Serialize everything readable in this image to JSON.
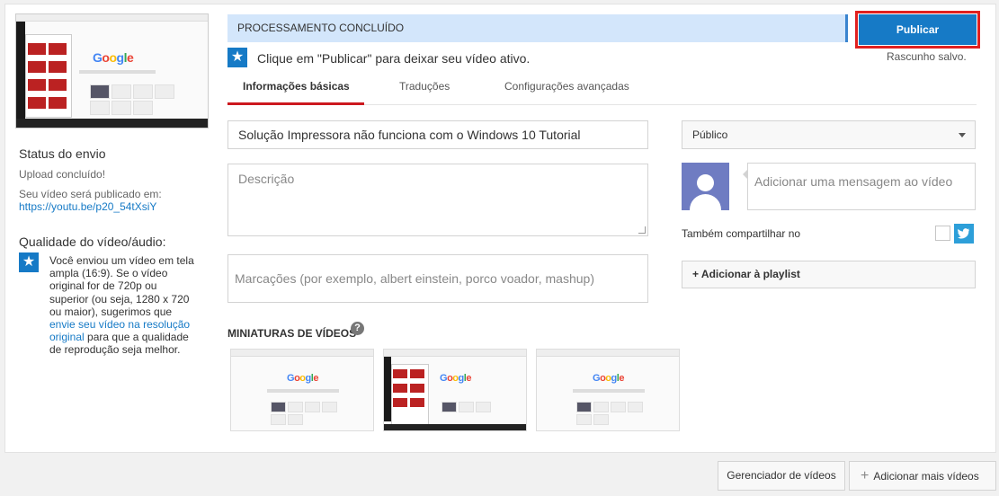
{
  "preview": {
    "google_text": [
      "G",
      "o",
      "o",
      "g",
      "l",
      "e"
    ]
  },
  "sidebar": {
    "status_title": "Status do envio",
    "upload_done": "Upload concluído!",
    "publish_note": "Seu vídeo será publicado em:",
    "video_url": "https://youtu.be/p20_54tXsiY",
    "quality_title": "Qualidade do vídeo/áudio:",
    "quality_pre": "Você enviou um vídeo em tela ampla (16:9). Se o vídeo original for de 720p ou superior (ou seja, 1280 x 720 ou maior), sugerimos que ",
    "quality_link": "envie seu vídeo na resolução original",
    "quality_post": " para que a qualidade de reprodução seja melhor."
  },
  "status": {
    "processing_label": "PROCESSAMENTO CONCLUÍDO",
    "publish_label": "Publicar",
    "draft_label": "Rascunho salvo.",
    "hint": "Clique em \"Publicar\" para deixar seu vídeo ativo."
  },
  "tabs": [
    {
      "label": "Informações básicas",
      "active": true
    },
    {
      "label": "Traduções",
      "active": false
    },
    {
      "label": "Configurações avançadas",
      "active": false
    }
  ],
  "form": {
    "title_value": "Solução Impressora não funciona com o Windows 10   Tutorial",
    "description_placeholder": "Descrição",
    "tags_placeholder": "Marcações (por exemplo, albert einstein, porco voador, mashup)",
    "privacy_value": "Público",
    "message_placeholder": "Adicionar uma mensagem ao vídeo",
    "share_label": "Também compartilhar no",
    "playlist_label": "+ Adicionar à playlist"
  },
  "thumbnails": {
    "title": "MINIATURAS DE VÍDEOS",
    "help": "?"
  },
  "footer": {
    "manager_label": "Gerenciador de vídeos",
    "add_more_label": "Adicionar mais vídeos"
  },
  "colors": {
    "accent_blue": "#167ac6",
    "publish_outline": "#e0201f",
    "processing_bg": "#d3e6fb",
    "tab_underline": "#cc181e",
    "twitter": "#2d9fd9",
    "avatar": "#6f7cc2"
  },
  "icons": {
    "hint": "star-badge-icon",
    "quality": "star-badge-icon",
    "help": "question-circle-icon",
    "privacy_caret": "chevron-down-icon",
    "share": "twitter-icon",
    "add_more": "plus-icon"
  }
}
